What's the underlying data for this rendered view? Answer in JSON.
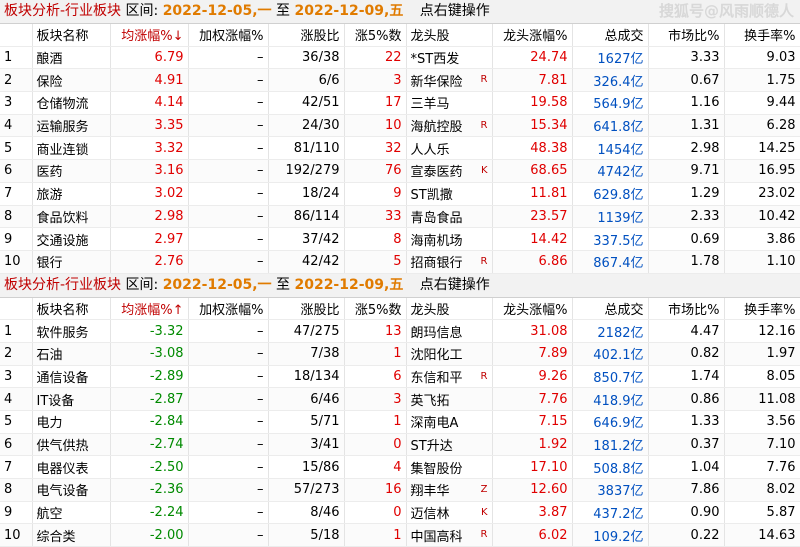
{
  "panels": [
    {
      "title": "板块分析-行业板块",
      "interval_label": "区间:",
      "date_start": "2022-12-05,一",
      "date_to": "至",
      "date_end": "2022-12-09,五",
      "hint": "点右键操作",
      "headers": [
        "",
        "板块名称",
        "均涨幅%↓",
        "加权涨幅%",
        "涨股比",
        "涨5%数",
        "龙头股",
        "龙头涨幅%",
        "总成交",
        "市场比%",
        "换手率%"
      ],
      "rows": [
        {
          "idx": "1",
          "name": "酿酒",
          "avg": "6.79",
          "w": "–",
          "ratio": "36/38",
          "up5": "22",
          "lead": "*ST西发",
          "flag": "",
          "lead_pct": "24.74",
          "vol": "1627亿",
          "mkt": "3.33",
          "turn": "9.03"
        },
        {
          "idx": "2",
          "name": "保险",
          "avg": "4.91",
          "w": "–",
          "ratio": "6/6",
          "up5": "3",
          "lead": "新华保险",
          "flag": "R",
          "lead_pct": "7.81",
          "vol": "326.4亿",
          "mkt": "0.67",
          "turn": "1.75"
        },
        {
          "idx": "3",
          "name": "仓储物流",
          "avg": "4.14",
          "w": "–",
          "ratio": "42/51",
          "up5": "17",
          "lead": "三羊马",
          "flag": "",
          "lead_pct": "19.58",
          "vol": "564.9亿",
          "mkt": "1.16",
          "turn": "9.44"
        },
        {
          "idx": "4",
          "name": "运输服务",
          "avg": "3.35",
          "w": "–",
          "ratio": "24/30",
          "up5": "10",
          "lead": "海航控股",
          "flag": "R",
          "lead_pct": "15.34",
          "vol": "641.8亿",
          "mkt": "1.31",
          "turn": "6.28"
        },
        {
          "idx": "5",
          "name": "商业连锁",
          "avg": "3.32",
          "w": "–",
          "ratio": "81/110",
          "up5": "32",
          "lead": "人人乐",
          "flag": "",
          "lead_pct": "48.38",
          "vol": "1454亿",
          "mkt": "2.98",
          "turn": "14.25"
        },
        {
          "idx": "6",
          "name": "医药",
          "avg": "3.16",
          "w": "–",
          "ratio": "192/279",
          "up5": "76",
          "lead": "宣泰医药",
          "flag": "K",
          "lead_pct": "68.65",
          "vol": "4742亿",
          "mkt": "9.71",
          "turn": "16.95"
        },
        {
          "idx": "7",
          "name": "旅游",
          "avg": "3.02",
          "w": "–",
          "ratio": "18/24",
          "up5": "9",
          "lead": "ST凯撒",
          "flag": "",
          "lead_pct": "11.81",
          "vol": "629.8亿",
          "mkt": "1.29",
          "turn": "23.02"
        },
        {
          "idx": "8",
          "name": "食品饮料",
          "avg": "2.98",
          "w": "–",
          "ratio": "86/114",
          "up5": "33",
          "lead": "青岛食品",
          "flag": "",
          "lead_pct": "23.57",
          "vol": "1139亿",
          "mkt": "2.33",
          "turn": "10.42"
        },
        {
          "idx": "9",
          "name": "交通设施",
          "avg": "2.97",
          "w": "–",
          "ratio": "37/42",
          "up5": "8",
          "lead": "海南机场",
          "flag": "",
          "lead_pct": "14.42",
          "vol": "337.5亿",
          "mkt": "0.69",
          "turn": "3.86"
        },
        {
          "idx": "10",
          "name": "银行",
          "avg": "2.76",
          "w": "–",
          "ratio": "42/42",
          "up5": "5",
          "lead": "招商银行",
          "flag": "R",
          "lead_pct": "6.86",
          "vol": "867.4亿",
          "mkt": "1.78",
          "turn": "1.10"
        }
      ]
    },
    {
      "title": "板块分析-行业板块",
      "interval_label": "区间:",
      "date_start": "2022-12-05,一",
      "date_to": "至",
      "date_end": "2022-12-09,五",
      "hint": "点右键操作",
      "headers": [
        "",
        "板块名称",
        "均涨幅%↑",
        "加权涨幅%",
        "涨股比",
        "涨5%数",
        "龙头股",
        "龙头涨幅%",
        "总成交",
        "市场比%",
        "换手率%"
      ],
      "rows": [
        {
          "idx": "1",
          "name": "软件服务",
          "avg": "-3.32",
          "w": "–",
          "ratio": "47/275",
          "up5": "13",
          "lead": "朗玛信息",
          "flag": "",
          "lead_pct": "31.08",
          "vol": "2182亿",
          "mkt": "4.47",
          "turn": "12.16"
        },
        {
          "idx": "2",
          "name": "石油",
          "avg": "-3.08",
          "w": "–",
          "ratio": "7/38",
          "up5": "1",
          "lead": "沈阳化工",
          "flag": "",
          "lead_pct": "7.89",
          "vol": "402.1亿",
          "mkt": "0.82",
          "turn": "1.97"
        },
        {
          "idx": "3",
          "name": "通信设备",
          "avg": "-2.89",
          "w": "–",
          "ratio": "18/134",
          "up5": "6",
          "lead": "东信和平",
          "flag": "R",
          "lead_pct": "9.26",
          "vol": "850.7亿",
          "mkt": "1.74",
          "turn": "8.05"
        },
        {
          "idx": "4",
          "name": "IT设备",
          "avg": "-2.87",
          "w": "–",
          "ratio": "6/46",
          "up5": "3",
          "lead": "英飞拓",
          "flag": "",
          "lead_pct": "7.76",
          "vol": "418.9亿",
          "mkt": "0.86",
          "turn": "11.08"
        },
        {
          "idx": "5",
          "name": "电力",
          "avg": "-2.84",
          "w": "–",
          "ratio": "5/71",
          "up5": "1",
          "lead": "深南电A",
          "flag": "",
          "lead_pct": "7.15",
          "vol": "646.9亿",
          "mkt": "1.33",
          "turn": "3.56"
        },
        {
          "idx": "6",
          "name": "供气供热",
          "avg": "-2.74",
          "w": "–",
          "ratio": "3/41",
          "up5": "0",
          "lead": "ST升达",
          "flag": "",
          "lead_pct": "1.92",
          "vol": "181.2亿",
          "mkt": "0.37",
          "turn": "7.10"
        },
        {
          "idx": "7",
          "name": "电器仪表",
          "avg": "-2.50",
          "w": "–",
          "ratio": "15/86",
          "up5": "4",
          "lead": "集智股份",
          "flag": "",
          "lead_pct": "17.10",
          "vol": "508.8亿",
          "mkt": "1.04",
          "turn": "7.76"
        },
        {
          "idx": "8",
          "name": "电气设备",
          "avg": "-2.36",
          "w": "–",
          "ratio": "57/273",
          "up5": "16",
          "lead": "翔丰华",
          "flag": "Z",
          "lead_pct": "12.60",
          "vol": "3837亿",
          "mkt": "7.86",
          "turn": "8.02"
        },
        {
          "idx": "9",
          "name": "航空",
          "avg": "-2.24",
          "w": "–",
          "ratio": "8/46",
          "up5": "0",
          "lead": "迈信林",
          "flag": "K",
          "lead_pct": "3.87",
          "vol": "437.2亿",
          "mkt": "0.90",
          "turn": "5.87"
        },
        {
          "idx": "10",
          "name": "综合类",
          "avg": "-2.00",
          "w": "–",
          "ratio": "5/18",
          "up5": "1",
          "lead": "中国高科",
          "flag": "R",
          "lead_pct": "6.02",
          "vol": "109.2亿",
          "mkt": "0.22",
          "turn": "14.63"
        }
      ]
    }
  ],
  "watermark": "搜狐号@风雨顺德人",
  "colors": {
    "up": "#e00000",
    "down": "#008a00",
    "volume": "#0050c0",
    "title": "#c00000",
    "date": "#e07b00"
  }
}
